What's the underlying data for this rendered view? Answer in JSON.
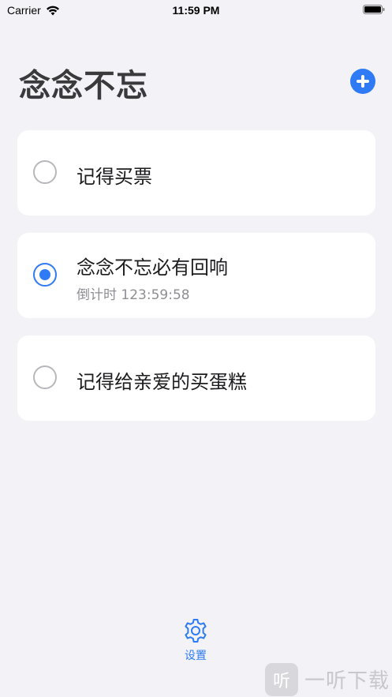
{
  "status_bar": {
    "carrier": "Carrier",
    "time": "11:59 PM"
  },
  "header": {
    "title": "念念不忘"
  },
  "colors": {
    "accent": "#2f7bf5",
    "background": "#f2f2f7",
    "card": "#ffffff",
    "secondary_text": "#8e8e93"
  },
  "items": [
    {
      "title": "记得买票",
      "checked": false
    },
    {
      "title": "念念不忘必有回响",
      "subtitle": "倒计时 123:59:58",
      "checked": true
    },
    {
      "title": "记得给亲爱的买蛋糕",
      "checked": false
    }
  ],
  "tab_bar": {
    "settings_label": "设置",
    "settings_icon": "gear-icon"
  },
  "watermark": {
    "logo_char": "听",
    "text": "一听下载"
  }
}
